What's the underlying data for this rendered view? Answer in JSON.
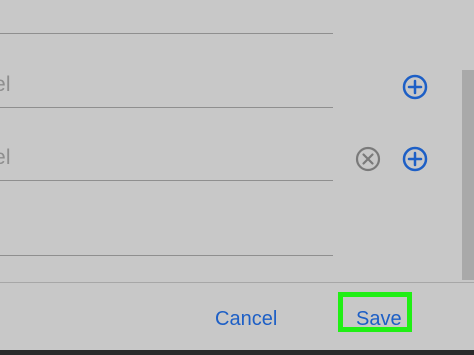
{
  "form": {
    "row1_placeholder": "el",
    "row2_placeholder": "el"
  },
  "icons": {
    "add": "plus-circle-icon",
    "remove": "close-circle-icon"
  },
  "actions": {
    "cancel_label": "Cancel",
    "save_label": "Save"
  },
  "colors": {
    "accent": "#1d5fc6",
    "highlight": "#20ef15",
    "background": "#c8c8c8"
  }
}
